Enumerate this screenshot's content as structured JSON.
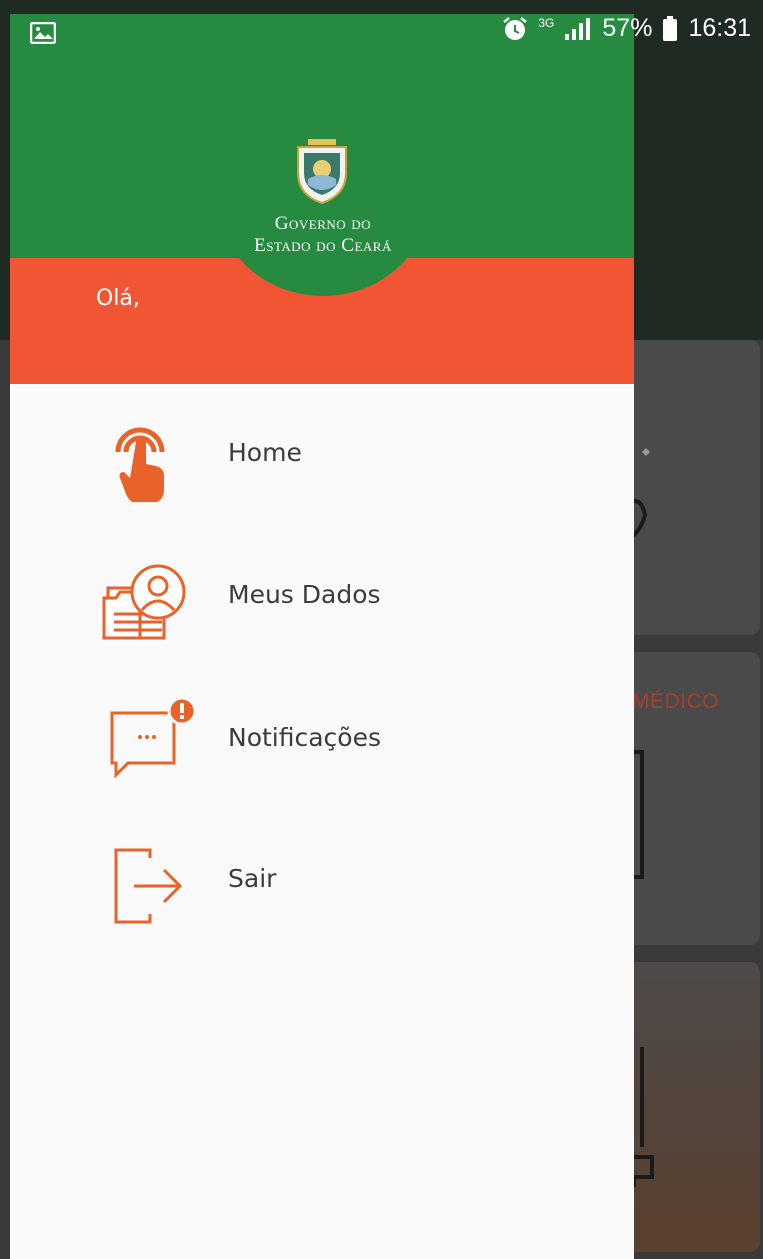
{
  "status_bar": {
    "network": "3G",
    "battery": "57%",
    "time": "16:31"
  },
  "drawer": {
    "logo": {
      "line1": "Governo do",
      "line2": "Estado do Ceará"
    },
    "greeting": "Olá,",
    "menu": [
      {
        "label": "Home",
        "icon": "tap-hand-icon"
      },
      {
        "label": "Meus Dados",
        "icon": "user-profile-icon"
      },
      {
        "label": "Notificações",
        "icon": "chat-notification-icon"
      },
      {
        "label": "Sair",
        "icon": "logout-icon"
      }
    ]
  },
  "background_app": {
    "card2_label": "MÉDICO"
  },
  "colors": {
    "green": "#268b41",
    "orange": "#f05633",
    "icon_orange": "#e8622a"
  }
}
